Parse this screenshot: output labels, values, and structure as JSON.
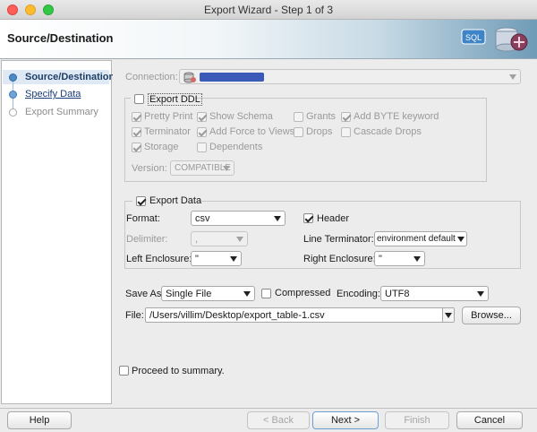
{
  "window": {
    "title": "Export Wizard - Step 1 of 3"
  },
  "header": {
    "title": "Source/Destination"
  },
  "steps": [
    {
      "label": "Source/Destination"
    },
    {
      "label": "Specify Data"
    },
    {
      "label": "Export Summary"
    }
  ],
  "connection": {
    "label": "Connection:",
    "value": ""
  },
  "export_ddl": {
    "label": "Export DDL",
    "checked": false,
    "options": {
      "pretty_print": "Pretty Print",
      "show_schema": "Show Schema",
      "grants": "Grants",
      "add_byte_keyword": "Add BYTE keyword",
      "terminator": "Terminator",
      "add_force_to_views": "Add Force to Views",
      "drops": "Drops",
      "cascade_drops": "Cascade Drops",
      "storage": "Storage",
      "dependents": "Dependents"
    },
    "version_label": "Version:",
    "version_value": "COMPATIBLE"
  },
  "export_data": {
    "label": "Export Data",
    "format_label": "Format:",
    "format_value": "csv",
    "header_label": "Header",
    "delimiter_label": "Delimiter:",
    "delimiter_value": ",",
    "line_terminator_label": "Line Terminator:",
    "line_terminator_value": "environment default",
    "left_enclosure_label": "Left Enclosure:",
    "left_enclosure_value": "\"",
    "right_enclosure_label": "Right Enclosure:",
    "right_enclosure_value": "\""
  },
  "save": {
    "save_as_label": "Save As",
    "save_as_value": "Single File",
    "compressed_label": "Compressed",
    "encoding_label": "Encoding:",
    "encoding_value": "UTF8",
    "file_label": "File:",
    "file_value": "/Users/villim/Desktop/export_table-1.csv",
    "browse_label": "Browse..."
  },
  "proceed_label": "Proceed to summary.",
  "buttons": {
    "help": "Help",
    "back": "< Back",
    "next": "Next >",
    "finish": "Finish",
    "cancel": "Cancel"
  }
}
